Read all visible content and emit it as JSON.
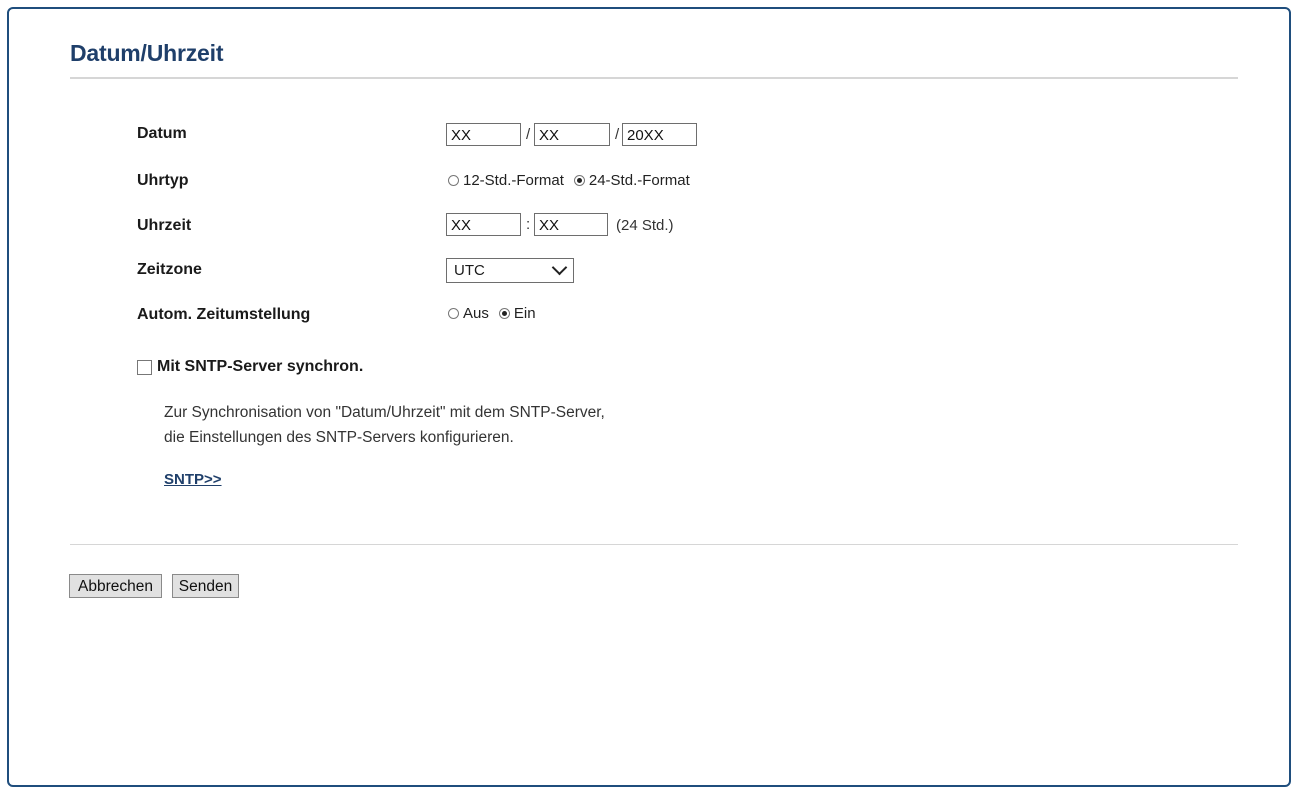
{
  "page": {
    "title": "Datum/Uhrzeit"
  },
  "date": {
    "label": "Datum",
    "day": "XX",
    "month": "XX",
    "year": "20XX",
    "separator": "/"
  },
  "clock_type": {
    "label": "Uhrtyp",
    "options": [
      "12-Std.-Format",
      "24-Std.-Format"
    ],
    "selected": "24-Std.-Format"
  },
  "time": {
    "label": "Uhrzeit",
    "hour": "XX",
    "minute": "XX",
    "separator": ":",
    "suffix": "(24 Std.)"
  },
  "timezone": {
    "label": "Zeitzone",
    "value": "UTC"
  },
  "dst": {
    "label": "Autom. Zeitumstellung",
    "options": [
      "Aus",
      "Ein"
    ],
    "selected": "Ein"
  },
  "sntp": {
    "checkbox_label": "Mit SNTP-Server synchron.",
    "checked": false,
    "desc_line1": "Zur Synchronisation von \"Datum/Uhrzeit\" mit dem SNTP-Server,",
    "desc_line2": "die Einstellungen des SNTP-Servers konfigurieren.",
    "link": "SNTP>>"
  },
  "buttons": {
    "cancel": "Abbrechen",
    "submit": "Senden"
  }
}
